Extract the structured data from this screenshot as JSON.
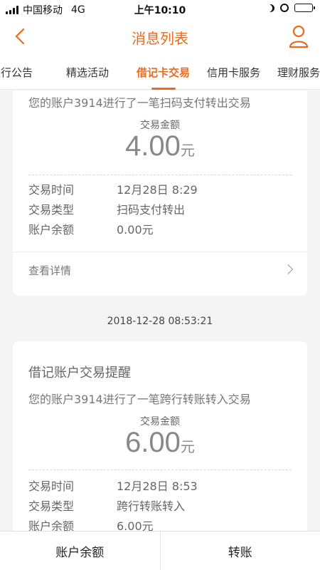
{
  "status_bar": {
    "carrier": "中国移动",
    "network": "4G",
    "time": "上午10:10",
    "battery_level": 0.45
  },
  "header": {
    "title": "消息列表"
  },
  "tabs": [
    {
      "label": "银行公告"
    },
    {
      "label": "精选活动"
    },
    {
      "label": "借记卡交易"
    },
    {
      "label": "信用卡服务"
    },
    {
      "label": "理财服务"
    }
  ],
  "active_tab": 2,
  "colors": {
    "accent": "#ea6b1f"
  },
  "messages": [
    {
      "desc": "您的账户3914进行了一笔扫码支付转出交易",
      "amount_label": "交易金额",
      "amount": "4.00",
      "unit": "元",
      "rows": [
        {
          "label": "交易时间",
          "value": "12月28日 8:29"
        },
        {
          "label": "交易类型",
          "value": "扫码支付转出"
        },
        {
          "label": "账户余额",
          "value": "0.00元"
        }
      ],
      "detail_link": "查看详情"
    },
    {
      "timestamp": "2018-12-28 08:53:21",
      "title": "借记账户交易提醒",
      "desc": "您的账户3914进行了一笔跨行转账转入交易",
      "amount_label": "交易金额",
      "amount": "6.00",
      "unit": "元",
      "rows": [
        {
          "label": "交易时间",
          "value": "12月28日 8:53"
        },
        {
          "label": "交易类型",
          "value": "跨行转账转入"
        },
        {
          "label": "账户余额",
          "value": "6.00元"
        }
      ]
    }
  ],
  "bottom_bar": {
    "balance_label": "账户余额",
    "transfer_label": "转账"
  }
}
